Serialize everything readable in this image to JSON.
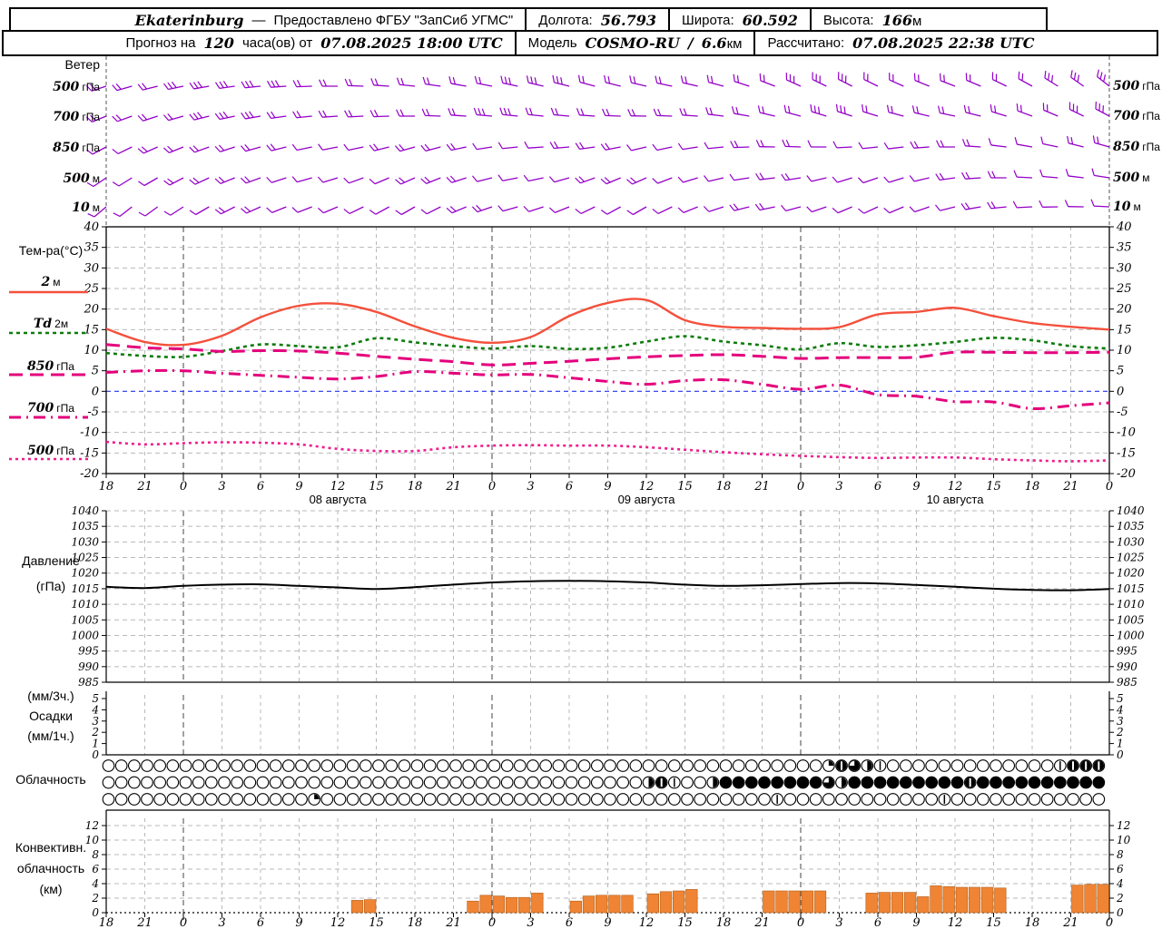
{
  "header": {
    "station": "Ekaterinburg",
    "dash": "—",
    "provider": "Предоставлено ФГБУ \"ЗапСиб УГМС\"",
    "lon_label": "Долгота:",
    "lon_value": "56.793",
    "lat_label": "Широта:",
    "lat_value": "60.592",
    "alt_label": "Высота:",
    "alt_value": "166",
    "alt_unit": "м",
    "fx_label_1": "Прогноз на",
    "fx_hours": "120",
    "fx_label_2": "часа(ов) от",
    "fx_time": "07.08.2025 18:00 UTC",
    "model_label": "Модель",
    "model_name": "COSMO-RU",
    "model_sep": "/",
    "model_res": "6.6",
    "model_res_unit": "км",
    "calc_label": "Рассчитано:",
    "calc_time": "07.08.2025 22:38 UTC"
  },
  "panels": {
    "wind": {
      "title": "Ветер",
      "rows": [
        {
          "num": "500",
          "unit": "гПа"
        },
        {
          "num": "700",
          "unit": "гПа"
        },
        {
          "num": "850",
          "unit": "гПа"
        },
        {
          "num": "500",
          "unit": "м"
        },
        {
          "num": "10",
          "unit": "м"
        }
      ]
    },
    "temperature": {
      "title": "Тем-ра(°C)",
      "legend": [
        {
          "num": "2",
          "unit": "м"
        },
        {
          "num": "Td",
          "unit": "2м"
        },
        {
          "num": "850",
          "unit": "гПа"
        },
        {
          "num": "700",
          "unit": "гПа"
        },
        {
          "num": "500",
          "unit": "гПа"
        }
      ]
    },
    "pressure": {
      "title_line1": "Давление",
      "title_line2": "(гПа)"
    },
    "precipitation": {
      "label_line1": "(мм/3ч.)",
      "label_line2": "Осадки",
      "label_line3": "(мм/1ч.)"
    },
    "cloud": {
      "title": "Облачность"
    },
    "convective": {
      "title_line1": "Конвективн.",
      "title_line2": "облачность",
      "title_line3": "(км)"
    }
  },
  "axis": {
    "hour_labels": [
      "18",
      "21",
      "0",
      "3",
      "6",
      "9",
      "12",
      "15",
      "18",
      "21",
      "0",
      "3",
      "6",
      "9",
      "12",
      "15",
      "18",
      "21",
      "0",
      "3",
      "6",
      "9",
      "12",
      "15",
      "18",
      "21",
      "0"
    ],
    "day_labels": [
      {
        "text": "08 августа",
        "hour": 18
      },
      {
        "text": "09 августа",
        "hour": 42
      },
      {
        "text": "10 августа",
        "hour": 66
      }
    ]
  },
  "chart_data": [
    {
      "type": "wind-barbs",
      "name": "wind",
      "color": "#9400c8",
      "step_hours": 2,
      "rows": [
        {
          "level": "500 гПа",
          "dirs": [
            252,
            254,
            256,
            258,
            260,
            262,
            264,
            266,
            268,
            270,
            272,
            274,
            276,
            278,
            280,
            281,
            282,
            283,
            284,
            285,
            284,
            283,
            282,
            283,
            285,
            288,
            291,
            294,
            296,
            297,
            296,
            294,
            292,
            291,
            293,
            296,
            299,
            302,
            305,
            308
          ],
          "barbs": [
            2,
            2,
            2,
            3,
            3,
            3,
            3,
            3,
            2,
            2,
            2,
            2,
            2,
            2,
            2,
            2,
            3,
            3,
            3,
            2,
            2,
            2,
            2,
            2,
            2,
            2,
            2,
            3,
            3,
            3,
            2,
            2,
            2,
            2,
            2,
            2,
            2,
            3,
            3,
            3
          ]
        },
        {
          "level": "700 гПа",
          "dirs": [
            248,
            250,
            252,
            254,
            256,
            258,
            260,
            262,
            264,
            266,
            267,
            268,
            270,
            272,
            274,
            275,
            276,
            276,
            275,
            274,
            272,
            271,
            272,
            274,
            277,
            280,
            283,
            285,
            287,
            288,
            287,
            285,
            283,
            282,
            284,
            287,
            290,
            293,
            296,
            298
          ],
          "barbs": [
            2,
            2,
            2,
            2,
            3,
            3,
            3,
            2,
            2,
            2,
            2,
            2,
            2,
            2,
            2,
            3,
            3,
            2,
            2,
            2,
            2,
            2,
            2,
            2,
            2,
            2,
            2,
            2,
            3,
            3,
            2,
            2,
            2,
            2,
            2,
            2,
            2,
            2,
            3,
            3
          ]
        },
        {
          "level": "850 гПа",
          "dirs": [
            242,
            244,
            246,
            248,
            250,
            252,
            254,
            256,
            258,
            259,
            258,
            256,
            254,
            255,
            258,
            261,
            264,
            266,
            265,
            262,
            259,
            257,
            258,
            261,
            264,
            268,
            271,
            272,
            270,
            267,
            264,
            263,
            266,
            270,
            274,
            277,
            280,
            282,
            284,
            286
          ],
          "barbs": [
            1,
            1,
            2,
            2,
            2,
            2,
            2,
            2,
            1,
            1,
            1,
            2,
            2,
            2,
            2,
            1,
            1,
            1,
            2,
            2,
            2,
            1,
            1,
            1,
            1,
            2,
            2,
            2,
            1,
            1,
            1,
            1,
            2,
            2,
            2,
            1,
            1,
            1,
            2,
            2
          ]
        },
        {
          "level": "500 м",
          "dirs": [
            236,
            238,
            240,
            242,
            245,
            248,
            250,
            252,
            254,
            253,
            250,
            247,
            246,
            248,
            252,
            256,
            259,
            258,
            254,
            250,
            247,
            246,
            249,
            253,
            257,
            261,
            263,
            261,
            257,
            253,
            251,
            253,
            257,
            262,
            266,
            270,
            273,
            275,
            277,
            279
          ],
          "barbs": [
            1,
            1,
            1,
            2,
            2,
            2,
            2,
            1,
            1,
            1,
            1,
            1,
            2,
            2,
            2,
            1,
            1,
            1,
            1,
            2,
            2,
            2,
            1,
            1,
            1,
            1,
            2,
            2,
            1,
            1,
            1,
            1,
            1,
            2,
            2,
            2,
            1,
            1,
            1,
            1
          ]
        },
        {
          "level": "10 м",
          "dirs": [
            230,
            232,
            234,
            237,
            240,
            243,
            246,
            248,
            249,
            247,
            244,
            241,
            240,
            243,
            247,
            251,
            254,
            252,
            248,
            244,
            241,
            240,
            244,
            248,
            252,
            256,
            258,
            255,
            251,
            247,
            245,
            247,
            251,
            256,
            260,
            264,
            267,
            269,
            271,
            273
          ],
          "barbs": [
            1,
            1,
            1,
            1,
            1,
            2,
            2,
            1,
            1,
            1,
            1,
            1,
            1,
            1,
            2,
            2,
            1,
            1,
            1,
            1,
            1,
            1,
            1,
            1,
            1,
            2,
            2,
            1,
            1,
            1,
            1,
            1,
            1,
            1,
            2,
            2,
            1,
            1,
            1,
            1
          ]
        }
      ]
    },
    {
      "type": "line",
      "name": "temperature",
      "unit": "°C",
      "ylim": [
        -20,
        40
      ],
      "zero_line_color": "#2233ee",
      "x_hours": [
        0,
        3,
        6,
        9,
        12,
        15,
        18,
        21,
        24,
        27,
        30,
        33,
        36,
        39,
        42,
        45,
        48,
        51,
        54,
        57,
        60,
        63,
        66,
        69,
        72,
        75,
        78
      ],
      "series": [
        {
          "name": "2м",
          "color": "#f4503c",
          "dash": "",
          "width": 2.4,
          "values": [
            15.2,
            12.0,
            11.3,
            13.5,
            18.0,
            20.8,
            21.3,
            19.3,
            15.8,
            13.0,
            11.8,
            13.2,
            18.3,
            21.5,
            22.2,
            17.3,
            15.7,
            15.4,
            15.2,
            15.6,
            18.7,
            19.3,
            20.3,
            18.3,
            16.6,
            15.7,
            15.0
          ]
        },
        {
          "name": "Td 2м",
          "color": "#0c7c0c",
          "dash": "4 4",
          "width": 2.6,
          "values": [
            9.3,
            8.6,
            8.4,
            9.8,
            11.4,
            11.0,
            10.7,
            12.9,
            11.9,
            11.0,
            10.4,
            11.0,
            10.3,
            10.6,
            12.1,
            13.4,
            12.1,
            11.2,
            10.2,
            11.7,
            10.8,
            11.2,
            12.0,
            13.0,
            12.4,
            11.0,
            10.4
          ]
        },
        {
          "name": "850 гПа",
          "color": "#e4007c",
          "dash": "15 8",
          "width": 3,
          "values": [
            11.4,
            10.6,
            10.3,
            9.7,
            9.9,
            9.8,
            9.3,
            8.5,
            7.8,
            7.2,
            6.4,
            6.8,
            7.3,
            7.9,
            8.4,
            8.7,
            8.9,
            8.5,
            8.0,
            8.2,
            8.2,
            8.3,
            9.5,
            9.5,
            9.4,
            9.4,
            9.5
          ]
        },
        {
          "name": "700 гПа",
          "color": "#e4007c",
          "dash": "13 6 2 6",
          "width": 3,
          "values": [
            4.6,
            5.0,
            5.0,
            4.4,
            3.9,
            3.4,
            3.0,
            3.6,
            4.8,
            4.4,
            4.0,
            4.1,
            3.3,
            2.4,
            1.7,
            2.6,
            2.8,
            1.7,
            0.5,
            1.5,
            -0.8,
            -1.2,
            -2.5,
            -2.6,
            -4.2,
            -3.5,
            -2.8
          ]
        },
        {
          "name": "500 гПа",
          "color": "#ee1e8e",
          "dash": "3 4",
          "width": 2.6,
          "values": [
            -12.3,
            -12.9,
            -12.6,
            -12.4,
            -12.5,
            -12.9,
            -14.0,
            -14.5,
            -14.5,
            -13.6,
            -13.2,
            -13.1,
            -13.2,
            -13.2,
            -13.6,
            -14.2,
            -14.8,
            -15.3,
            -15.7,
            -16.0,
            -16.2,
            -16.1,
            -16.1,
            -16.5,
            -16.8,
            -17.0,
            -16.8
          ]
        }
      ]
    },
    {
      "type": "line",
      "name": "pressure",
      "unit": "гПа",
      "ylim": [
        985,
        1040
      ],
      "color": "#000000",
      "x_step_hours": 3,
      "values": [
        1015.6,
        1015.2,
        1015.9,
        1016.3,
        1016.4,
        1015.9,
        1015.4,
        1014.9,
        1015.5,
        1016.3,
        1017.0,
        1017.4,
        1017.5,
        1017.4,
        1017.0,
        1016.3,
        1015.9,
        1016.1,
        1016.5,
        1016.8,
        1016.7,
        1016.2,
        1015.6,
        1015.0,
        1014.6,
        1014.5,
        1014.9
      ]
    },
    {
      "type": "bar",
      "name": "precipitation",
      "units": [
        "мм/3ч.",
        "мм/1ч."
      ],
      "ylim": [
        0,
        5
      ],
      "values": []
    },
    {
      "type": "symbols",
      "name": "cloud-cover",
      "symbol": "circle-fill-fraction",
      "step_hours": 1,
      "rows": [
        {
          "name": "row-1",
          "values": [
            0,
            0,
            0,
            0,
            0,
            0,
            0,
            0,
            0,
            0,
            0,
            0,
            0,
            0,
            0,
            0,
            0,
            0,
            0,
            0,
            0,
            0,
            0,
            0,
            0,
            0,
            0,
            0,
            0,
            0,
            0,
            0,
            0,
            0,
            0,
            0,
            0,
            0,
            0,
            0,
            0,
            0,
            0,
            0,
            0,
            0,
            0,
            0,
            0,
            0,
            0,
            0,
            0,
            0,
            0,
            0,
            0.25,
            0.9,
            0.75,
            0.5,
            0.1,
            0,
            0,
            0,
            0,
            0,
            0,
            0,
            0,
            0,
            0,
            0,
            0,
            0,
            0.1,
            0.9,
            0.9,
            0.9
          ]
        },
        {
          "name": "row-2",
          "values": [
            0,
            0,
            0,
            0,
            0,
            0,
            0,
            0,
            0,
            0,
            0,
            0,
            0,
            0,
            0,
            0,
            0,
            0,
            0,
            0,
            0,
            0,
            0,
            0,
            0,
            0,
            0,
            0,
            0,
            0,
            0,
            0,
            0,
            0,
            0,
            0,
            0,
            0,
            0,
            0,
            0,
            0,
            0.5,
            0.9,
            0.1,
            0,
            0,
            0.5,
            1,
            1,
            1,
            1,
            1,
            1,
            1,
            1,
            0.75,
            0.5,
            1,
            1,
            1,
            1,
            1,
            1,
            1,
            1,
            1,
            0.9,
            1,
            1,
            1,
            1,
            1,
            1,
            1,
            1,
            1,
            1
          ]
        },
        {
          "name": "row-3",
          "values": [
            0,
            0,
            0,
            0,
            0,
            0,
            0,
            0,
            0,
            0,
            0,
            0,
            0,
            0,
            0,
            0,
            0.25,
            0,
            0,
            0,
            0,
            0,
            0,
            0,
            0,
            0,
            0,
            0,
            0,
            0,
            0,
            0,
            0,
            0,
            0,
            0,
            0,
            0,
            0,
            0,
            0,
            0,
            0,
            0,
            0,
            0,
            0,
            0,
            0,
            0,
            0,
            0,
            0.1,
            0,
            0,
            0,
            0,
            0,
            0,
            0,
            0,
            0,
            0,
            0,
            0,
            0.1,
            0,
            0,
            0,
            0,
            0,
            0,
            0,
            0,
            0,
            0,
            0,
            0
          ]
        }
      ]
    },
    {
      "type": "bar",
      "name": "convective-cloudiness",
      "unit": "км",
      "ylim": [
        0,
        12
      ],
      "step_hours": 1,
      "color": "#ef8434",
      "values": [
        0,
        0,
        0,
        0,
        0,
        0,
        0,
        0,
        0,
        0,
        0,
        0,
        0,
        0,
        0,
        0,
        0,
        0,
        0,
        1.7,
        1.8,
        0,
        0,
        0,
        0,
        0,
        0,
        0,
        1.6,
        2.4,
        2.3,
        2.1,
        2.1,
        2.7,
        0,
        0,
        1.6,
        2.3,
        2.4,
        2.4,
        2.4,
        0,
        2.6,
        2.9,
        3.0,
        3.2,
        0,
        0,
        0,
        0,
        0,
        3.0,
        3.0,
        3.0,
        3.0,
        3.0,
        0,
        0,
        0,
        2.7,
        2.8,
        2.8,
        2.8,
        2.2,
        3.7,
        3.6,
        3.5,
        3.5,
        3.5,
        3.4,
        0,
        0,
        0,
        0,
        0,
        3.8,
        3.9,
        3.9
      ]
    }
  ],
  "yticks": {
    "temperature": [
      40,
      35,
      30,
      25,
      20,
      15,
      10,
      5,
      0,
      -5,
      -10,
      -15,
      -20
    ],
    "pressure": [
      1040,
      1035,
      1030,
      1025,
      1020,
      1015,
      1010,
      1005,
      1000,
      995,
      990,
      985
    ],
    "precipitation": [
      5,
      4,
      3,
      2,
      1,
      0
    ],
    "convective": [
      12,
      10,
      8,
      6,
      4,
      2,
      0
    ]
  }
}
